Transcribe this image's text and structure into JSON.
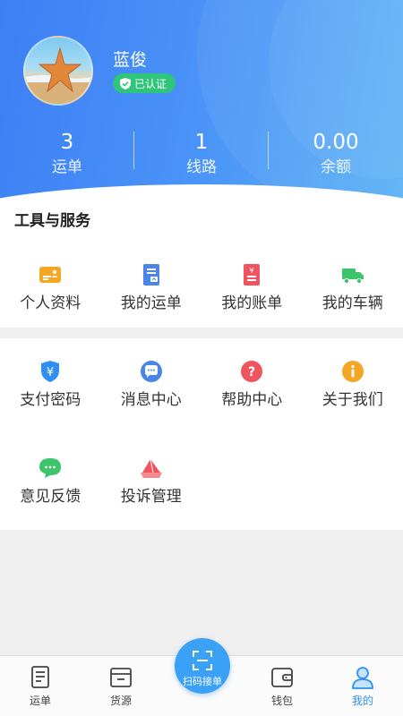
{
  "profile": {
    "name": "蓝俊",
    "badge": "已认证"
  },
  "stats": [
    {
      "value": "3",
      "label": "运单"
    },
    {
      "value": "1",
      "label": "线路"
    },
    {
      "value": "0.00",
      "label": "余额"
    }
  ],
  "tools": {
    "title": "工具与服务",
    "row1": [
      {
        "label": "个人资料",
        "icon": "id-card-icon",
        "color": "#f5a623"
      },
      {
        "label": "我的运单",
        "icon": "waybill-icon",
        "color": "#4a86e8"
      },
      {
        "label": "我的账单",
        "icon": "bill-icon",
        "color": "#f0555f"
      },
      {
        "label": "我的车辆",
        "icon": "truck-icon",
        "color": "#3cc46a"
      }
    ],
    "row2": [
      {
        "label": "支付密码",
        "icon": "yuan-shield-icon",
        "color": "#2f8ff2"
      },
      {
        "label": "消息中心",
        "icon": "chat-icon",
        "color": "#4a86e8"
      },
      {
        "label": "帮助中心",
        "icon": "question-icon",
        "color": "#f0555f"
      },
      {
        "label": "关于我们",
        "icon": "info-icon",
        "color": "#f5a623"
      }
    ],
    "row3": [
      {
        "label": "意见反馈",
        "icon": "feedback-icon",
        "color": "#3cc46a"
      },
      {
        "label": "投诉管理",
        "icon": "complaint-icon",
        "color": "#f0555f"
      }
    ]
  },
  "tabbar": {
    "items": [
      {
        "label": "运单"
      },
      {
        "label": "货源"
      },
      {
        "label": "钱包"
      },
      {
        "label": "我的"
      }
    ],
    "scan_label": "扫码接单",
    "active_color": "#2f8ff2"
  }
}
